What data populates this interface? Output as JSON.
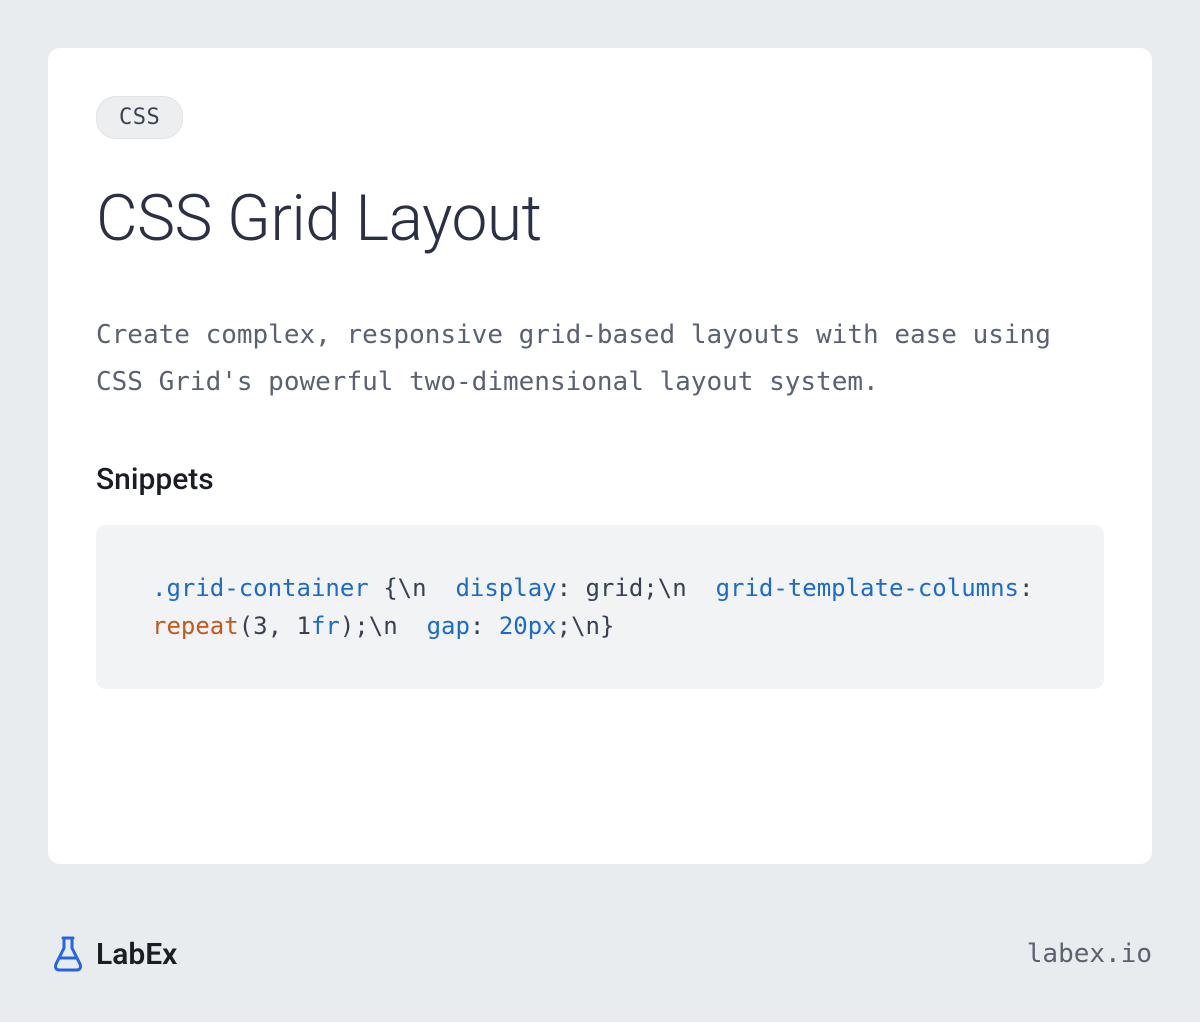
{
  "tag": "CSS",
  "title": "CSS Grid Layout",
  "description": "Create complex, responsive grid-based layouts with ease using CSS Grid's powerful two-dimensional layout system.",
  "section_heading": "Snippets",
  "code": {
    "selector": ".grid-container",
    "open_brace": " {\\n  ",
    "prop1": "display",
    "prop1_sep": ": grid;\\n  ",
    "prop2": "grid-template-columns",
    "prop2_sep": ": ",
    "func": "repeat",
    "func_args_open": "(3, 1",
    "unit": "fr",
    "func_close": ");\\n  ",
    "prop3": "gap",
    "prop3_sep": ": ",
    "value3": "20px",
    "close": ";\\n}"
  },
  "logo_text": "LabEx",
  "footer_url": "labex.io"
}
